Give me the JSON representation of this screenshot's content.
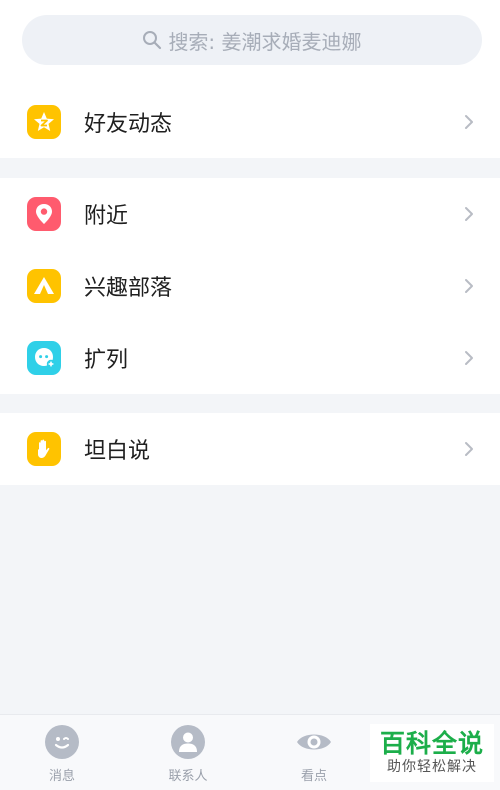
{
  "search": {
    "placeholder": "搜索: 姜潮求婚麦迪娜"
  },
  "groups": [
    {
      "items": [
        {
          "label": "好友动态",
          "icon": "qzone-star-icon",
          "color": "#ffc300"
        }
      ]
    },
    {
      "items": [
        {
          "label": "附近",
          "icon": "location-pin-icon",
          "color": "#ff5b6e"
        },
        {
          "label": "兴趣部落",
          "icon": "tent-icon",
          "color": "#ffc300"
        },
        {
          "label": "扩列",
          "icon": "add-friend-face-icon",
          "color": "#2fd0e8"
        }
      ]
    },
    {
      "items": [
        {
          "label": "坦白说",
          "icon": "raised-hand-icon",
          "color": "#ffc300"
        }
      ]
    }
  ],
  "tabbar": {
    "tabs": [
      {
        "label": "消息",
        "icon": "message-face-icon"
      },
      {
        "label": "联系人",
        "icon": "contacts-person-icon"
      },
      {
        "label": "看点",
        "icon": "eye-icon"
      }
    ]
  },
  "watermark": {
    "title": "百科全说",
    "subtitle": "助你轻松解决"
  }
}
